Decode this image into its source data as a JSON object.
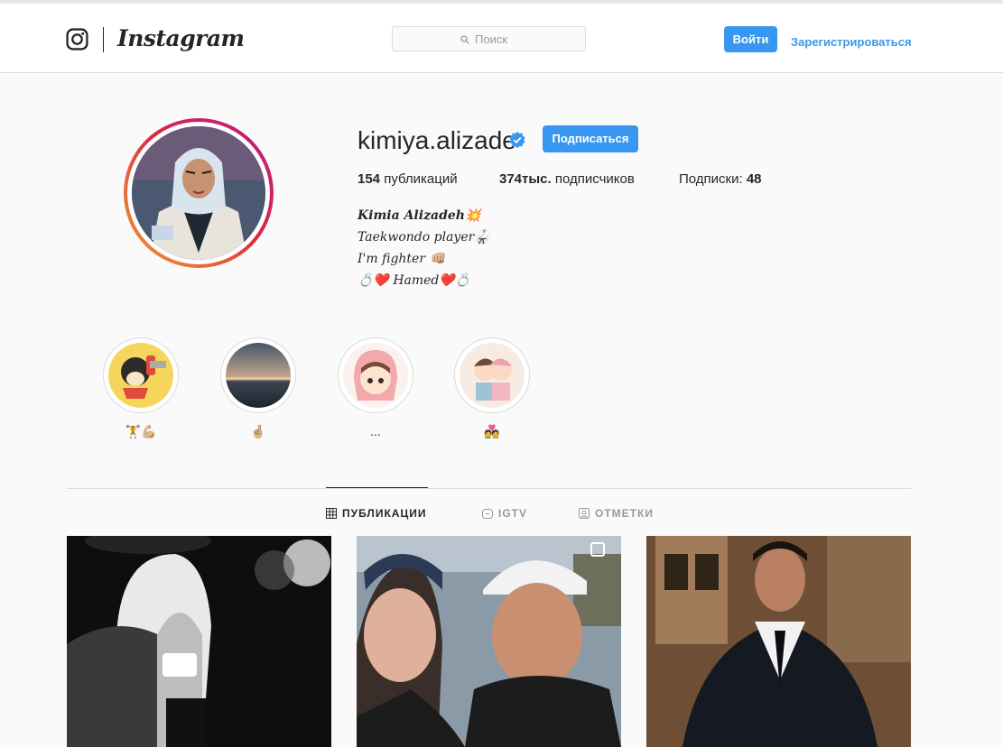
{
  "header": {
    "brand": "Instagram",
    "search_placeholder": "Поиск",
    "login_label": "Войти",
    "signup_label": "Зарегистрироваться"
  },
  "profile": {
    "username": "kimiya.alizade",
    "follow_label": "Подписаться",
    "stats": {
      "posts_count": "154",
      "posts_label": "публикаций",
      "followers_count": "374тыс.",
      "followers_label": "подписчиков",
      "following_label": "Подписки:",
      "following_count": "48"
    },
    "bio": {
      "line1": "Kimia Alizadeh💥",
      "line2": "Taekwondo player🥋",
      "line3": "I'm fighter 👊🏼",
      "line4": "💍❤️ Hamed❤️💍"
    }
  },
  "highlights": [
    {
      "label": "🏋️💪🏼"
    },
    {
      "label": "🤞🏼"
    },
    {
      "label": "..."
    },
    {
      "label": "💑"
    }
  ],
  "tabs": [
    {
      "label": "ПУБЛИКАЦИИ",
      "active": true
    },
    {
      "label": "IGTV",
      "active": false
    },
    {
      "label": "ОТМЕТКИ",
      "active": false
    }
  ],
  "colors": {
    "accent": "#3897f0",
    "text": "#262626",
    "muted": "#999999",
    "border": "#dbdbdb"
  }
}
